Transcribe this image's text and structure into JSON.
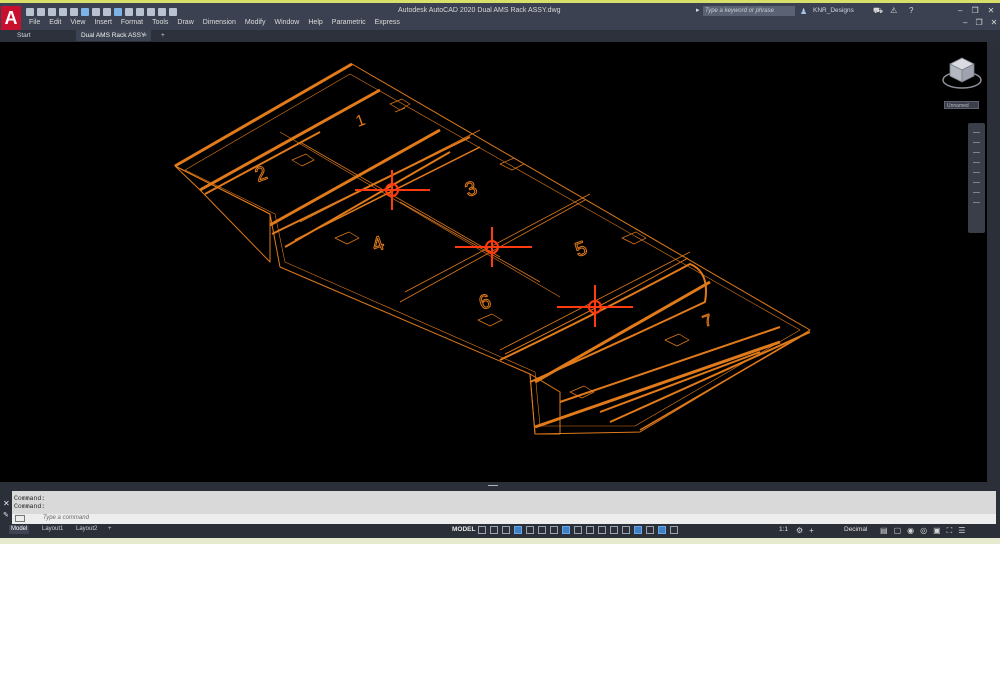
{
  "app": {
    "title": "Autodesk AutoCAD 2020   Dual AMS Rack ASSY.dwg",
    "logo_letter": "A",
    "search_placeholder": "Type a keyword or phrase",
    "user": "KNR_Designs"
  },
  "menu": [
    "File",
    "Edit",
    "View",
    "Insert",
    "Format",
    "Tools",
    "Draw",
    "Dimension",
    "Modify",
    "Window",
    "Help",
    "Parametric",
    "Express"
  ],
  "tabs": {
    "start": "Start",
    "document": "Dual AMS Rack ASSY",
    "close": "×",
    "add": "+"
  },
  "viewport": {
    "background": "#000000",
    "wire_color": "#e07a1a",
    "highlight_color": "#ff3a10",
    "view_name": "Unnamed",
    "slot_numbers": [
      "1",
      "2",
      "3",
      "4",
      "5",
      "6",
      "7"
    ]
  },
  "command": {
    "history": [
      "Command:",
      "Command:"
    ],
    "placeholder": "Type a command"
  },
  "layout_tabs": [
    "Model",
    "Layout1",
    "Layout2"
  ],
  "layout_add": "+",
  "status": {
    "model": "MODEL",
    "scale": "1:1",
    "units": "Decimal"
  },
  "icons": [
    "search-icon",
    "user-icon",
    "help-icon",
    "minimize-icon",
    "restore-icon",
    "close-icon",
    "viewcube-icon",
    "grid-icon",
    "snap-icon",
    "ortho-icon",
    "polar-icon",
    "osnap-icon",
    "settings-icon",
    "plus-icon",
    "fullscreen-icon",
    "menu-icon"
  ]
}
